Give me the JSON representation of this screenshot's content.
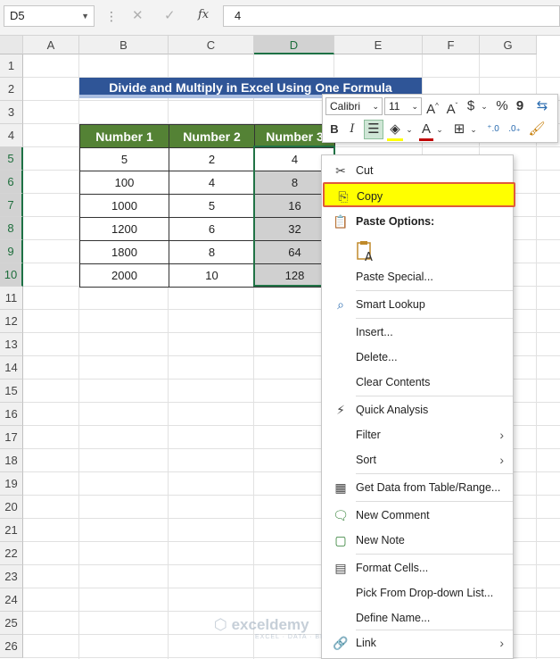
{
  "formula_bar": {
    "name_box": "D5",
    "fx": "fx",
    "value": "4"
  },
  "columns": [
    "A",
    "B",
    "C",
    "D",
    "E",
    "F",
    "G"
  ],
  "rows": [
    "1",
    "2",
    "3",
    "4",
    "5",
    "6",
    "7",
    "8",
    "9",
    "10",
    "11",
    "12",
    "13",
    "14",
    "15",
    "16",
    "17",
    "18",
    "19",
    "20",
    "21",
    "22",
    "23",
    "24",
    "25",
    "26"
  ],
  "sheet": {
    "title": "Divide and Multiply in Excel Using One Formula",
    "headers": [
      "Number 1",
      "Number 2",
      "Number 3"
    ],
    "data": [
      [
        "5",
        "2",
        "4"
      ],
      [
        "100",
        "4",
        "8"
      ],
      [
        "1000",
        "5",
        "16"
      ],
      [
        "1200",
        "6",
        "32"
      ],
      [
        "1800",
        "8",
        "64"
      ],
      [
        "2000",
        "10",
        "128"
      ]
    ]
  },
  "mini_toolbar": {
    "font": "Calibri",
    "size": "11",
    "bold": "B",
    "italic": "I"
  },
  "context_menu": {
    "cut": "Cut",
    "copy": "Copy",
    "paste_options": "Paste Options:",
    "paste_special": "Paste Special...",
    "smart_lookup": "Smart Lookup",
    "insert": "Insert...",
    "delete": "Delete...",
    "clear_contents": "Clear Contents",
    "quick_analysis": "Quick Analysis",
    "filter": "Filter",
    "sort": "Sort",
    "get_data": "Get Data from Table/Range...",
    "new_comment": "New Comment",
    "new_note": "New Note",
    "format_cells": "Format Cells...",
    "pick_dropdown": "Pick From Drop-down List...",
    "define_name": "Define Name...",
    "link": "Link"
  },
  "watermark": {
    "name": "exceldemy",
    "tagline": "EXCEL · DATA · BI"
  },
  "colors": {
    "title_bg": "#2f5597",
    "header_bg": "#548235",
    "highlight": "#ffff00",
    "highlight_border": "#e05a3a",
    "selection": "#217346"
  }
}
